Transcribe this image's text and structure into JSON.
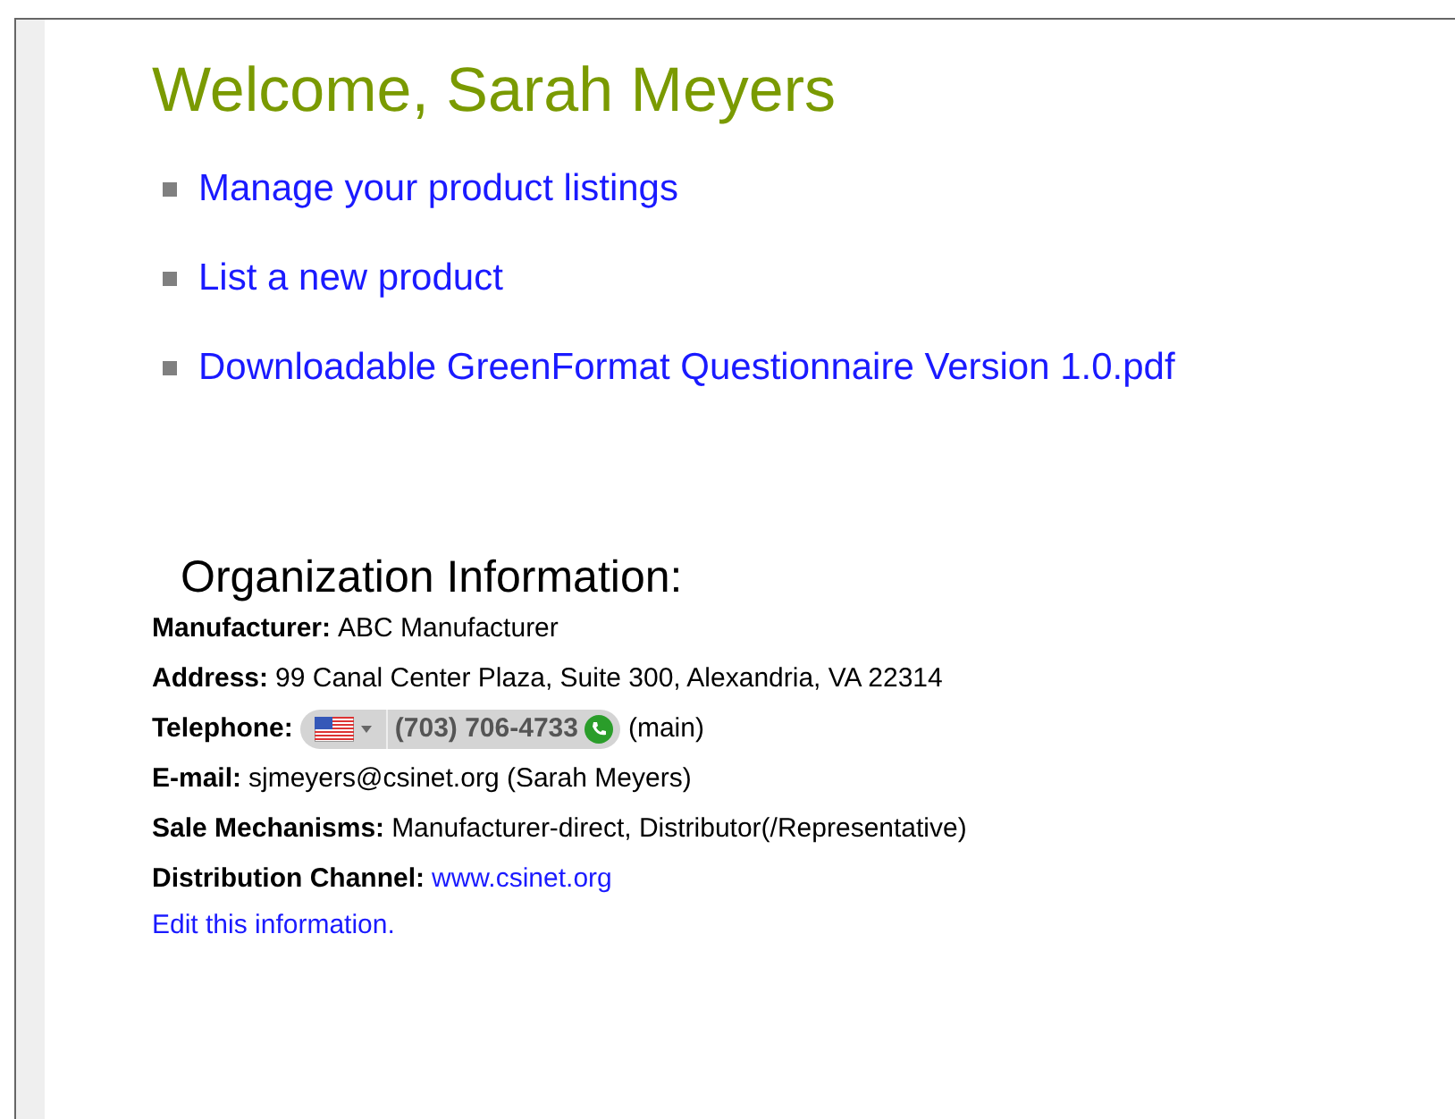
{
  "heading": "Welcome, Sarah Meyers",
  "links": [
    "Manage your product listings",
    "List a new product",
    "Downloadable GreenFormat Questionnaire Version 1.0.pdf"
  ],
  "organization": {
    "title": "Organization Information:",
    "fields": [
      {
        "kind": "text",
        "label": "Manufacturer:",
        "value": "ABC Manufacturer"
      },
      {
        "kind": "text",
        "label": "Address:",
        "value": "99 Canal Center Plaza, Suite 300, Alexandria, VA 22314"
      },
      {
        "kind": "phone",
        "label": "Telephone:",
        "value": "(703) 706-4733",
        "note": "(main)"
      },
      {
        "kind": "text",
        "label": "E-mail:",
        "value": "sjmeyers@csinet.org (Sarah Meyers)"
      },
      {
        "kind": "text",
        "label": "Sale Mechanisms:",
        "value": "Manufacturer-direct, Distributor(/Representative)"
      },
      {
        "kind": "link",
        "label": "Distribution Channel:",
        "value": "www.csinet.org"
      }
    ],
    "edit_link": "Edit this information."
  }
}
